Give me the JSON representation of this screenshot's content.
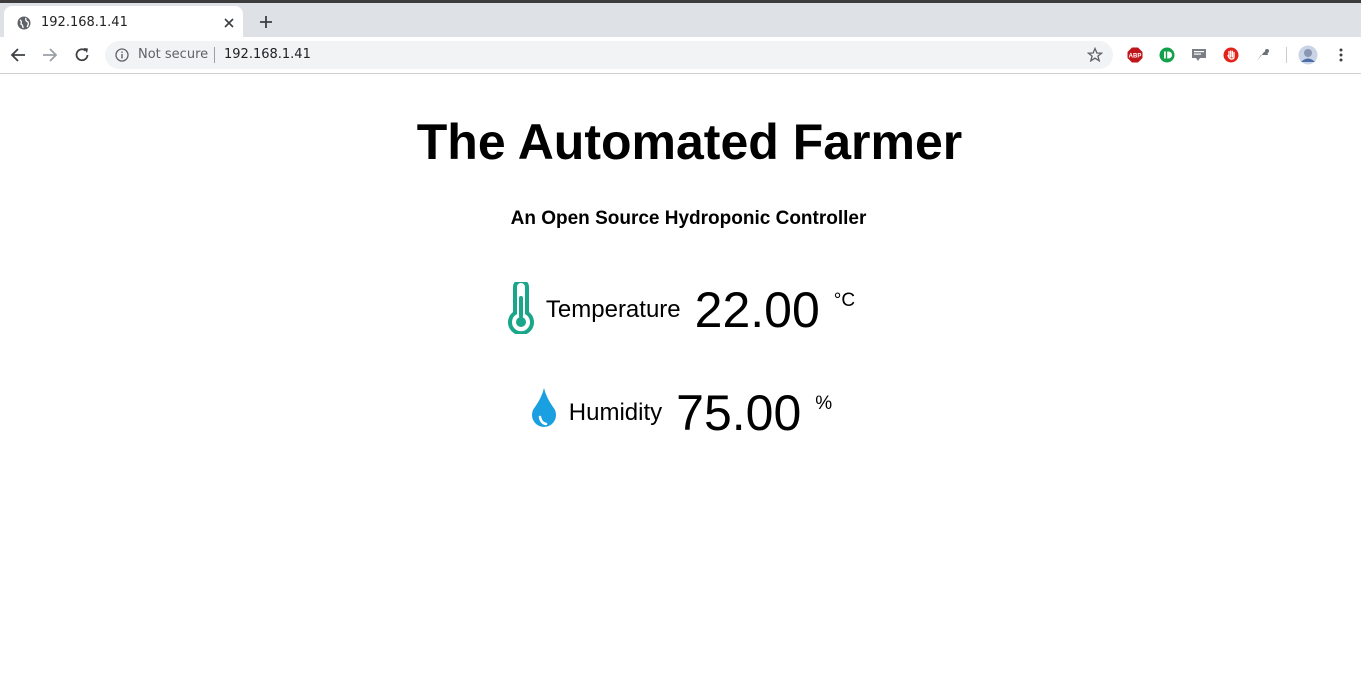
{
  "browser": {
    "tab_title": "192.168.1.41",
    "security_label": "Not secure",
    "url": "192.168.1.41",
    "extensions": [
      "abp-icon",
      "extension-green-icon",
      "extension-grey-icon",
      "stop-icon",
      "extension-cast-icon",
      "profile-avatar"
    ]
  },
  "page": {
    "title": "The Automated Farmer",
    "subtitle": "An Open Source Hydroponic Controller",
    "temperature": {
      "label": "Temperature",
      "value": "22.00",
      "unit": "°C",
      "icon": "thermometer-icon",
      "color": "#1aa68a"
    },
    "humidity": {
      "label": "Humidity",
      "value": "75.00",
      "unit": "%",
      "icon": "water-drop-icon",
      "color": "#1aa0e0"
    }
  }
}
